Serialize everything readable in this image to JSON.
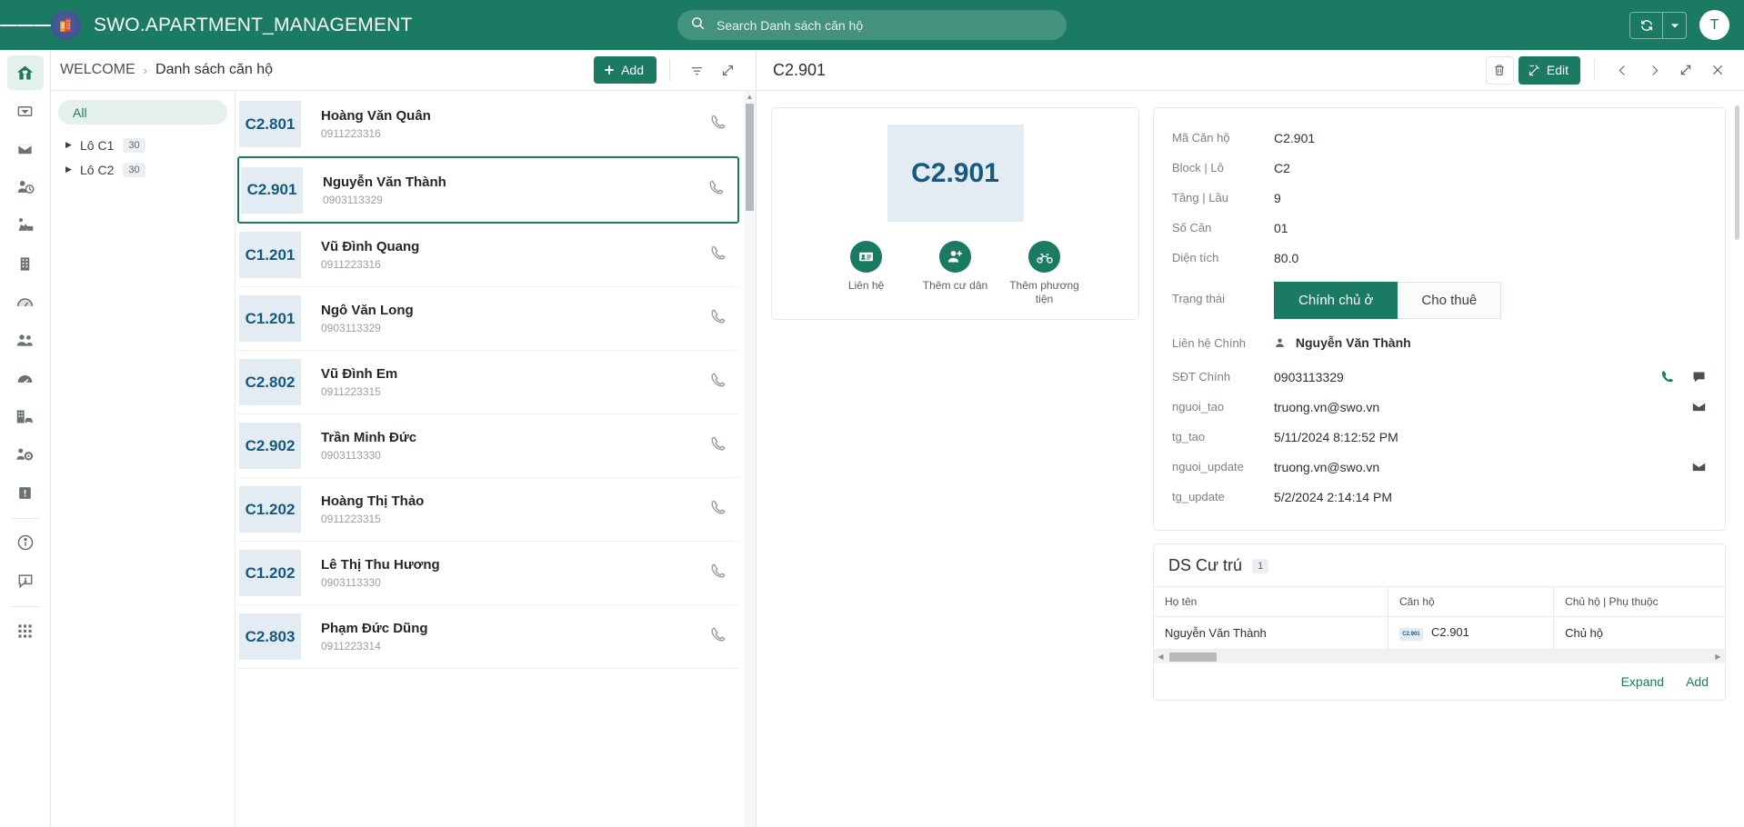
{
  "topbar": {
    "menu_icon": "hamburger-icon",
    "logo_icon": "building-logo-icon",
    "title": "SWO.APARTMENT_MANAGEMENT",
    "search_placeholder": "Search Danh sách căn hộ",
    "search_value": "",
    "search_icon": "search-icon",
    "sync_icon": "sync-icon",
    "caret_icon": "chevron-down-icon",
    "avatar_initial": "T",
    "brand_color": "#1a7a62"
  },
  "rail": {
    "items": [
      {
        "icon": "home-icon",
        "active": true
      },
      {
        "icon": "dropdown-box-icon",
        "active": false
      },
      {
        "icon": "envelope-icon",
        "active": false
      },
      {
        "icon": "person-clock-icon",
        "active": false
      },
      {
        "icon": "worker-icon",
        "active": false
      },
      {
        "icon": "building-icon",
        "active": false
      },
      {
        "icon": "gauge-icon",
        "active": false
      },
      {
        "icon": "people-icon",
        "active": false
      },
      {
        "icon": "speedometer-icon",
        "active": false
      },
      {
        "icon": "building-car-icon",
        "active": false
      },
      {
        "icon": "people-gear-icon",
        "active": false
      },
      {
        "icon": "alert-icon",
        "active": false
      },
      {
        "icon": "info-icon",
        "active": false
      },
      {
        "icon": "feedback-icon",
        "active": false
      },
      {
        "icon": "apps-grid-icon",
        "active": false
      }
    ]
  },
  "breadcrumb": {
    "root": "WELCOME",
    "separator": "›",
    "current": "Danh sách căn hộ",
    "add_label": "Add",
    "add_icon": "plus-icon",
    "filter_icon": "filter-icon",
    "expand_icon": "expand-icon"
  },
  "tree": {
    "all_label": "All",
    "nodes": [
      {
        "label": "Lô C1",
        "count": "30",
        "arrow": "caret-right-icon"
      },
      {
        "label": "Lô C2",
        "count": "30",
        "arrow": "caret-right-icon"
      }
    ]
  },
  "list": {
    "call_icon": "phone-icon",
    "rows": [
      {
        "code": "C2.801",
        "name": "Hoàng Văn Quân",
        "phone": "0911223316",
        "selected": false
      },
      {
        "code": "C2.901",
        "name": "Nguyễn Văn Thành",
        "phone": "0903113329",
        "selected": true
      },
      {
        "code": "C1.201",
        "name": "Vũ Đình Quang",
        "phone": "0911223316",
        "selected": false
      },
      {
        "code": "C1.201",
        "name": "Ngô Văn Long",
        "phone": "0903113329",
        "selected": false
      },
      {
        "code": "C2.802",
        "name": "Vũ Đình Em",
        "phone": "0911223315",
        "selected": false
      },
      {
        "code": "C2.902",
        "name": "Trần Minh Đức",
        "phone": "0903113330",
        "selected": false
      },
      {
        "code": "C1.202",
        "name": "Hoàng Thị Thảo",
        "phone": "0911223315",
        "selected": false
      },
      {
        "code": "C1.202",
        "name": "Lê Thị Thu Hương",
        "phone": "0903113330",
        "selected": false
      },
      {
        "code": "C2.803",
        "name": "Phạm Đức Dũng",
        "phone": "0911223314",
        "selected": false
      }
    ]
  },
  "detail": {
    "title": "C2.901",
    "delete_icon": "trash-icon",
    "edit_label": "Edit",
    "edit_icon": "edit-icon",
    "prev_icon": "chevron-left-icon",
    "next_icon": "chevron-right-icon",
    "expand_icon": "expand-icon",
    "close_icon": "close-icon",
    "photo_code": "C2.901",
    "quick_actions": [
      {
        "label": "Liên hệ",
        "icon": "contact-card-icon"
      },
      {
        "label": "Thêm cư dân",
        "icon": "person-add-icon"
      },
      {
        "label": "Thêm phương tiện",
        "icon": "motorbike-icon"
      }
    ],
    "fields": [
      {
        "label": "Mã Căn hộ",
        "value": "C2.901"
      },
      {
        "label": "Block | Lô",
        "value": "C2"
      },
      {
        "label": "Tầng | Lầu",
        "value": "9"
      },
      {
        "label": "Số Căn",
        "value": "01"
      },
      {
        "label": "Diện tích",
        "value": "80.0"
      }
    ],
    "status": {
      "label": "Trạng thái",
      "option_on": "Chính chủ ở",
      "option_off": "Cho thuê"
    },
    "contact": {
      "label": "Liên hệ Chính",
      "name": "Nguyễn Văn Thành",
      "person_icon": "person-icon"
    },
    "meta": [
      {
        "label": "SĐT Chính",
        "value": "0903113329",
        "icons": [
          "phone-call-icon",
          "chat-icon"
        ]
      },
      {
        "label": "nguoi_tao",
        "value": "truong.vn@swo.vn",
        "icons": [
          "envelope-icon"
        ]
      },
      {
        "label": "tg_tao",
        "value": "5/11/2024 8:12:52 PM",
        "icons": []
      },
      {
        "label": "nguoi_update",
        "value": "truong.vn@swo.vn",
        "icons": [
          "envelope-icon"
        ]
      },
      {
        "label": "tg_update",
        "value": "5/2/2024 2:14:14 PM",
        "icons": []
      }
    ],
    "residents": {
      "title": "DS Cư trú",
      "count": "1",
      "columns": [
        "Họ tên",
        "Căn hộ",
        "Chủ hộ | Phụ thuộc"
      ],
      "rows": [
        {
          "name": "Nguyễn Văn Thành",
          "apartment": "C2.901",
          "apartment_badge": "C2.901",
          "role": "Chủ hộ"
        }
      ],
      "expand_label": "Expand",
      "add_label": "Add"
    }
  }
}
